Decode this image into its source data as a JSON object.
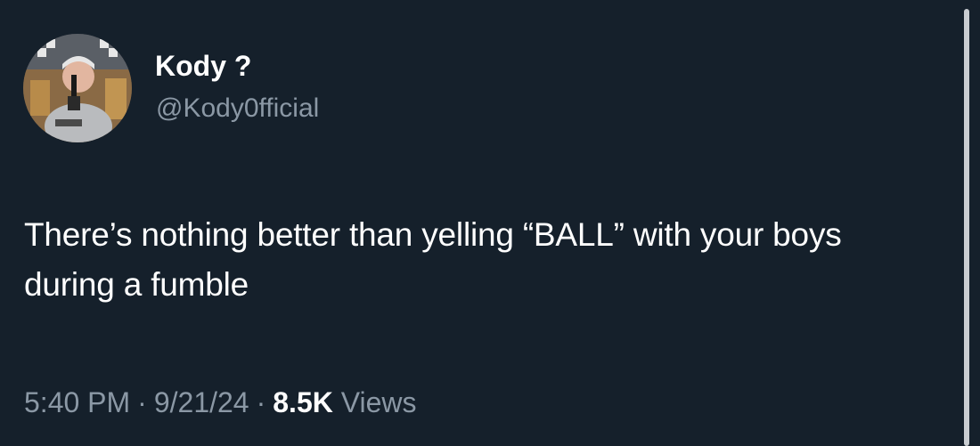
{
  "tweet": {
    "author": {
      "display_name": "Kody ?",
      "handle": "@Kody0fficial",
      "avatar_icon": "avatar-photo"
    },
    "text": "There’s nothing better than yelling “BALL” with your boys during a fumble",
    "meta": {
      "time": "5:40 PM",
      "separator": "·",
      "date": "9/21/24",
      "views_count": "8.5K",
      "views_label": "Views"
    }
  },
  "colors": {
    "background": "#15202b",
    "primary_text": "#ffffff",
    "secondary_text": "#8b98a5",
    "scrollbar": "#c9cdd1"
  }
}
